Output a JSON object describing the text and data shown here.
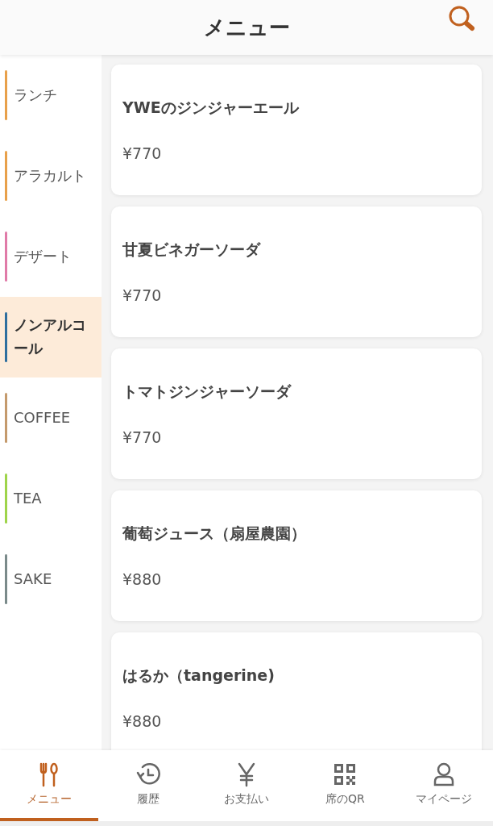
{
  "header": {
    "title": "メニュー"
  },
  "categories": [
    {
      "label": "ランチ",
      "color": "#e8a04a",
      "selected": false
    },
    {
      "label": "アラカルト",
      "color": "#e8a04a",
      "selected": false
    },
    {
      "label": "デザート",
      "color": "#e07aa8",
      "selected": false
    },
    {
      "label": "ノンアルコール",
      "color": "#2e6e9e",
      "selected": true
    },
    {
      "label": "COFFEE",
      "color": "#c49a6c",
      "selected": false
    },
    {
      "label": "TEA",
      "color": "#9ed44a",
      "selected": false
    },
    {
      "label": "SAKE",
      "color": "#7a8a8a",
      "selected": false
    }
  ],
  "items": [
    {
      "name": "YWEのジンジャーエール",
      "price": "¥770"
    },
    {
      "name": "甘夏ビネガーソーダ",
      "price": "¥770"
    },
    {
      "name": "トマトジンジャーソーダ",
      "price": "¥770"
    },
    {
      "name": "葡萄ジュース（扇屋農園）",
      "price": "¥880"
    },
    {
      "name": "はるか（tangerine)",
      "price": "¥880"
    }
  ],
  "nav": [
    {
      "label": "メニュー",
      "selected": true
    },
    {
      "label": "履歴",
      "selected": false
    },
    {
      "label": "お支払い",
      "selected": false
    },
    {
      "label": "席のQR",
      "selected": false
    },
    {
      "label": "マイページ",
      "selected": false
    }
  ]
}
